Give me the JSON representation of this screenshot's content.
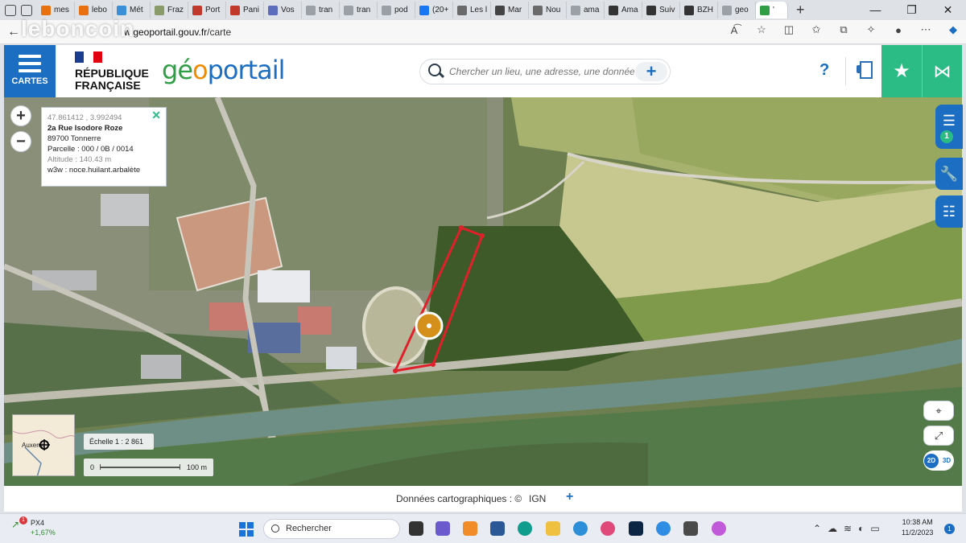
{
  "browser": {
    "tabs": [
      {
        "label": "mes",
        "color": "#e8700e"
      },
      {
        "label": "lebo",
        "color": "#e8700e"
      },
      {
        "label": "Mét",
        "color": "#3a8fd6"
      },
      {
        "label": "Fraz",
        "color": "#8a9b6a"
      },
      {
        "label": "Port",
        "color": "#c0392b"
      },
      {
        "label": "Pani",
        "color": "#c0392b"
      },
      {
        "label": "Vos",
        "color": "#5d6dbe"
      },
      {
        "label": "tran",
        "color": "#9aa0a6"
      },
      {
        "label": "tran",
        "color": "#9aa0a6"
      },
      {
        "label": "pod",
        "color": "#9aa0a6"
      },
      {
        "label": "(20+",
        "color": "#1877f2"
      },
      {
        "label": "Les l",
        "color": "#6a6a6a"
      },
      {
        "label": "Mar",
        "color": "#444"
      },
      {
        "label": "Nou",
        "color": "#6a6a6a"
      },
      {
        "label": "ama",
        "color": "#9aa0a6"
      },
      {
        "label": "Ama",
        "color": "#333"
      },
      {
        "label": "Suiv",
        "color": "#333"
      },
      {
        "label": "BZH",
        "color": "#333"
      },
      {
        "label": "geo",
        "color": "#9aa0a6"
      },
      {
        "label": "'",
        "color": "#2f9e44"
      }
    ],
    "new_tab": "+",
    "url_host": "w.geoportail.gouv.fr",
    "url_path": "/carte",
    "watermark": "leboncoin"
  },
  "header": {
    "cartes_label": "CARTES",
    "rf_line1": "RÉPUBLIQUE",
    "rf_line2": "FRANÇAISE",
    "logo_geo": "gé",
    "logo_o": "o",
    "logo_rest": "portail",
    "search_placeholder": "Chercher un lieu, une adresse, une donnée",
    "search_plus": "+",
    "help": "?"
  },
  "popup": {
    "coords": "47.861412 , 3.992494",
    "address": "2a Rue Isodore Roze",
    "city": "89700 Tonnerre",
    "parcel": "Parcelle : 000 / 0B / 0014",
    "altitude": "Altitude : 140.43 m",
    "w3w": "w3w : noce.huilant.arbalète",
    "close": "✕"
  },
  "map": {
    "zoom_in": "+",
    "zoom_out": "−",
    "layer_count": "1",
    "minimap_label": "Auxerre",
    "scale_label": "Échelle 1 : 2 861",
    "scale_zero": "0",
    "scale_dist": "100 m",
    "btn_2d": "2D",
    "btn_3d": "3D"
  },
  "footer": {
    "credits": "Données cartographiques : ©",
    "ign": "IGN",
    "plus": "+"
  },
  "taskbar": {
    "stock_name": "PX4",
    "stock_change": "+1,67%",
    "stock_badge": "1",
    "search_label": "Rechercher",
    "time": "10:38 AM",
    "date": "11/2/2023",
    "notif_count": "1"
  },
  "colors": {
    "primary": "#1b6ec2",
    "accent": "#2bbb85",
    "parcel_outline": "#e0202a",
    "marker": "#d4901a"
  }
}
